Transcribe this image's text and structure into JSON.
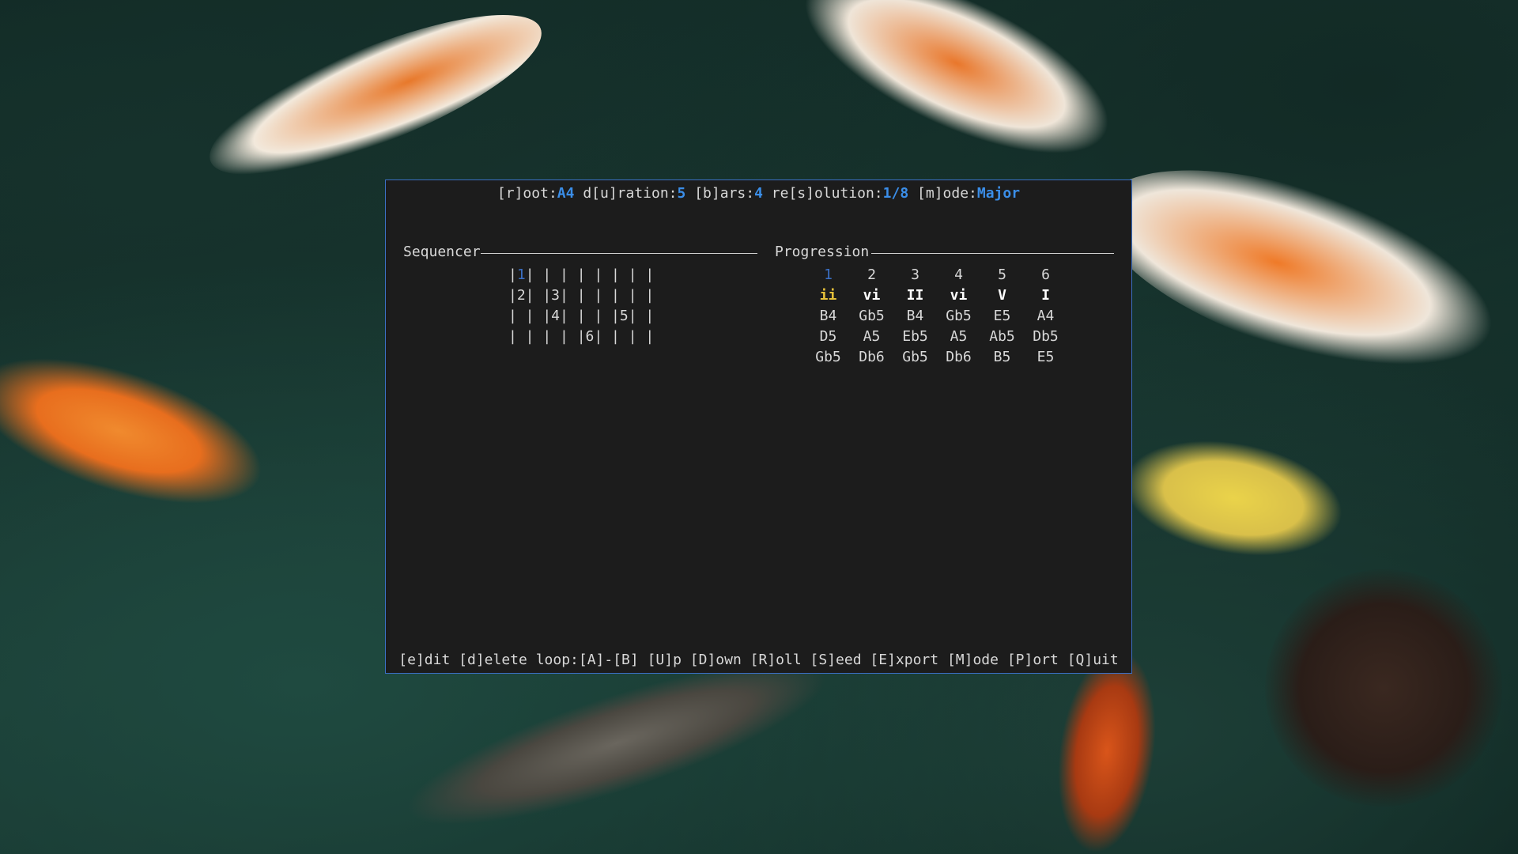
{
  "header": {
    "root_label": "[r]oot:",
    "root_value": "A4",
    "duration_label": "d[u]ration:",
    "duration_value": "5",
    "bars_label": "[b]ars:",
    "bars_value": "4",
    "resolution_label": "re[s]olution:",
    "resolution_value": "1/8",
    "mode_label": "[m]ode:",
    "mode_value": "Major"
  },
  "sections": {
    "sequencer": "Sequencer",
    "progression": "Progression"
  },
  "sequencer_rows": [
    [
      "|",
      "1",
      "| | | | | | | |"
    ],
    [
      "|2| |3| | | | | |",
      "",
      ""
    ],
    [
      "| | |4| | | |5| |",
      "",
      ""
    ],
    [
      "| | | | |6| | | |",
      "",
      ""
    ]
  ],
  "progression": {
    "numbers": [
      "1",
      "2",
      "3",
      "4",
      "5",
      "6"
    ],
    "numerals": [
      "ii",
      "vi",
      "II",
      "vi",
      "V",
      "I"
    ],
    "notes_row1": [
      "B4",
      "Gb5",
      "B4",
      "Gb5",
      "E5",
      "A4"
    ],
    "notes_row2": [
      "D5",
      "A5",
      "Eb5",
      "A5",
      "Ab5",
      "Db5"
    ],
    "notes_row3": [
      "Gb5",
      "Db6",
      "Gb5",
      "Db6",
      "B5",
      "E5"
    ],
    "selected_index": 0
  },
  "footer": {
    "edit": "[e]dit",
    "delete": "[d]elete",
    "loop": "loop:[A]-[B]",
    "up": "[U]p",
    "down": "[D]own",
    "roll": "[R]oll",
    "seed": "[S]eed",
    "export": "[E]xport",
    "mode": "[M]ode",
    "port": "[P]ort",
    "quit": "[Q]uit"
  },
  "colors": {
    "accent": "#3b8ee8",
    "border": "#3b6fc4",
    "selected_numeral": "#e6c13a",
    "background": "#1c1c1c"
  }
}
